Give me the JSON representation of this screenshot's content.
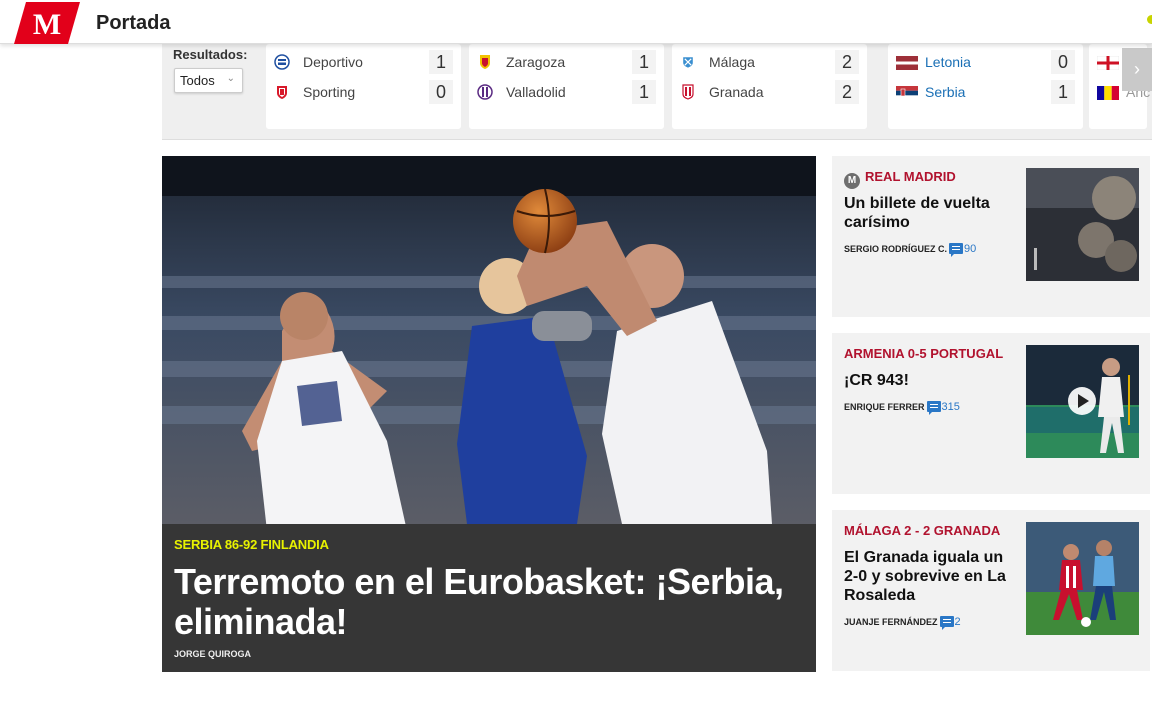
{
  "header": {
    "title": "Portada",
    "logo_text": "M"
  },
  "results": {
    "label": "Resultados:",
    "filter_value": "Todos",
    "matches": [
      {
        "home": {
          "name": "Deportivo",
          "score": "1"
        },
        "away": {
          "name": "Sporting",
          "score": "0"
        }
      },
      {
        "home": {
          "name": "Zaragoza",
          "score": "1"
        },
        "away": {
          "name": "Valladolid",
          "score": "1"
        }
      },
      {
        "home": {
          "name": "Málaga",
          "score": "2"
        },
        "away": {
          "name": "Granada",
          "score": "2"
        }
      },
      {
        "home": {
          "name": "Letonia",
          "score": "0"
        },
        "away": {
          "name": "Serbia",
          "score": "1"
        }
      },
      {
        "home": {
          "name": ""
        },
        "away": {
          "name": "Anc"
        }
      }
    ],
    "next_icon": "chevron-right-icon"
  },
  "hero": {
    "kicker": "SERBIA 86-92 FINLANDIA",
    "title": "Terremoto en el Eurobasket: ¡Serbia, eliminada!",
    "author": "JORGE QUIROGA"
  },
  "side_news": [
    {
      "kicker": "REAL MADRID",
      "title": "Un billete de vuelta carísimo",
      "author": "SERGIO RODRÍGUEZ C.",
      "comments": "90"
    },
    {
      "kicker": "ARMENIA 0-5 PORTUGAL",
      "title": "¡CR 943!",
      "author": "ENRIQUE FERRER",
      "comments": "315"
    },
    {
      "kicker": "MÁLAGA 2 - 2 GRANADA",
      "title": "El Granada iguala un 2-0 y sobrevive en La Rosaleda",
      "author": "JUANJE FERNÁNDEZ",
      "comments": "2"
    }
  ],
  "colors": {
    "brand_red": "#e2001a",
    "kicker_red": "#b1122e",
    "hero_kicker": "#e8f200",
    "link_blue": "#1a6fb5"
  }
}
